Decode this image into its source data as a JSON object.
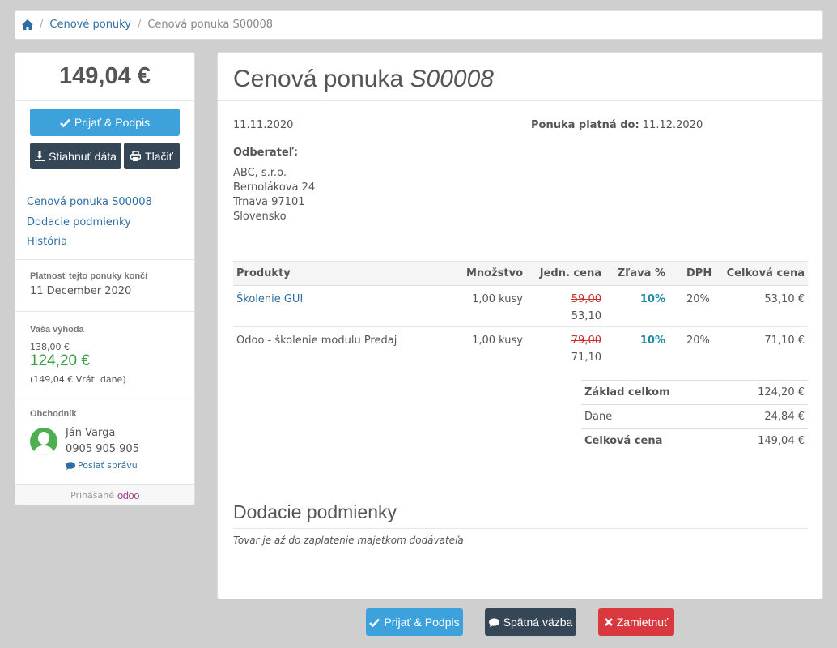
{
  "breadcrumb": {
    "home_icon": "home-icon",
    "items": [
      "Cenové ponuky",
      "Cenová ponuka S00008"
    ]
  },
  "sidebar": {
    "total": "149,04 €",
    "accept_label": "Prijať & Podpis",
    "download_label": "Stiahnuť dáta",
    "print_label": "Tlačiť",
    "nav": [
      "Cenová ponuka S00008",
      "Dodacie podmienky",
      "História"
    ],
    "validity_label": "Platnosť tejto ponuky končí",
    "validity_value": "11 December 2020",
    "benefit_label": "Vaša výhoda",
    "old_price": "138,00 €",
    "new_price": "124,20 €",
    "incl_tax": "(149,04 € Vrát. dane)",
    "salesperson_label": "Obchodník",
    "salesperson_name": "Ján Varga",
    "salesperson_phone": "0905 905 905",
    "send_message": "Poslať správu",
    "powered_by": "Prinášané",
    "powered_logo": "odoo"
  },
  "main": {
    "title_prefix": "Cenová ponuka",
    "title_number": "S00008",
    "date": "11.11.2020",
    "valid_until_label": "Ponuka platná do:",
    "valid_until_value": "11.12.2020",
    "customer_label": "Odberateľ:",
    "address": [
      "ABC, s.r.o.",
      "Bernolákova 24",
      "Trnava 97101",
      "Slovensko"
    ],
    "columns": [
      "Produkty",
      "Množstvo",
      "Jedn. cena",
      "Zľava %",
      "DPH",
      "Celková cena"
    ],
    "lines": [
      {
        "product": "Školenie GUI",
        "qty": "1,00 kusy",
        "old_price": "59,00",
        "price": "53,10",
        "discount": "10%",
        "tax": "20%",
        "total": "53,10 €"
      },
      {
        "product": "Odoo - školenie modulu Predaj",
        "qty": "1,00 kusy",
        "old_price": "79,00",
        "price": "71,10",
        "discount": "10%",
        "tax": "20%",
        "total": "71,10 €"
      }
    ],
    "totals": [
      {
        "label": "Základ celkom",
        "value": "124,20 €"
      },
      {
        "label": "Dane",
        "value": "24,84 €"
      },
      {
        "label": "Celková cena",
        "value": "149,04 €"
      }
    ],
    "terms_title": "Dodacie podmienky",
    "terms_text": "Tovar je až do zaplatenie majetkom dodávateľa"
  },
  "footer_buttons": {
    "accept": "Prijať & Podpis",
    "feedback": "Spätná väzba",
    "reject": "Zamietnuť"
  },
  "colors": {
    "primary": "#3da1dc",
    "dark": "#354657",
    "danger": "#d9383e",
    "link": "#2e6da4",
    "success": "#3e9d47"
  }
}
